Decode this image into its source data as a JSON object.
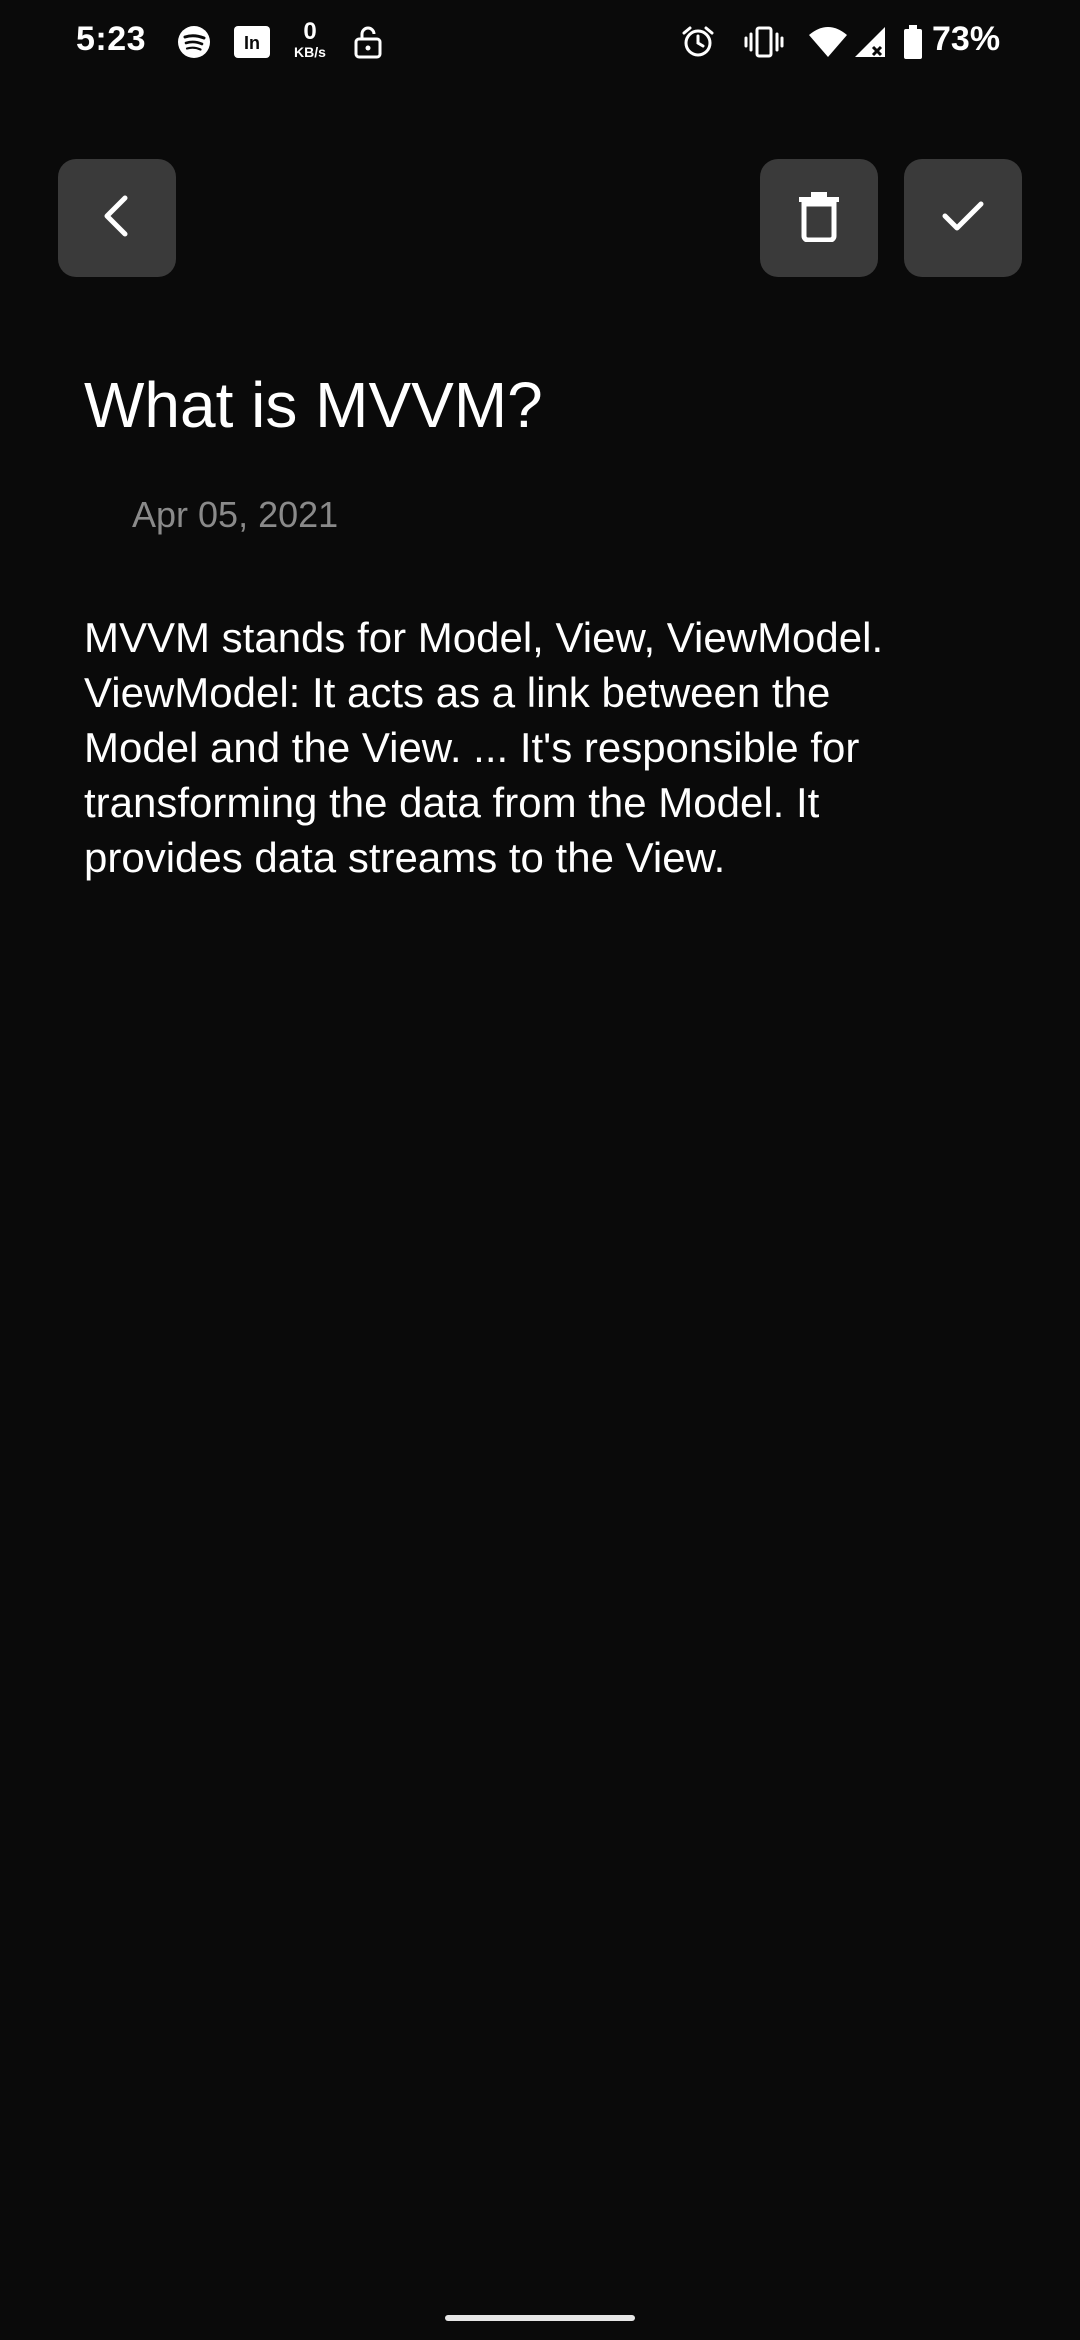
{
  "status_bar": {
    "time": "5:23",
    "net_speed_value": "0",
    "net_speed_unit": "KB/s",
    "battery": "73%",
    "left_icons": [
      "spotify-icon",
      "linkedin-icon",
      "net-speed-indicator",
      "unlock-icon"
    ],
    "right_icons": [
      "alarm-icon",
      "vibrate-icon",
      "wifi-icon",
      "cellular-no-signal-icon",
      "battery-icon"
    ]
  },
  "toolbar": {
    "back_icon": "chevron-left-icon",
    "delete_icon": "trash-icon",
    "save_icon": "check-icon"
  },
  "note": {
    "title": "What is MVVM?",
    "date": "Apr 05, 2021",
    "body": "MVVM stands for Model, View, ViewModel.\nViewModel: It acts as a link between the\nModel and the View. ... It's responsible for\ntransforming the data from the Model. It\nprovides data streams to the View."
  },
  "colors": {
    "background": "#0a0a0a",
    "button_bg": "#3a3a3a",
    "text_primary": "#ffffff",
    "text_secondary": "#8a8a8a"
  }
}
